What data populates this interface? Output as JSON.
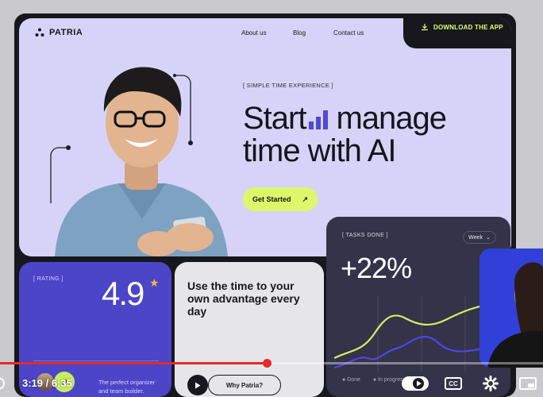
{
  "app": {
    "logo_text": "PATRIA",
    "nav": [
      "About us",
      "Blog",
      "Contact us"
    ],
    "download_label": "DOWNLOAD THE APP"
  },
  "hero": {
    "tag": "[ SIMPLE TIME EXPERIENCE ]",
    "headline_part1": "Start",
    "headline_part2": "manage",
    "headline_line2": "time with AI",
    "cta_label": "Get Started",
    "cta_icon": "arrow-up-right-icon"
  },
  "rating_card": {
    "label": "[ RATING ]",
    "value": "4.9",
    "organizer_text": "The perfect organizer and team builder."
  },
  "use_card": {
    "title": "Use the time to your own advantage every day",
    "button_label": "Why Patria?"
  },
  "tasks_card": {
    "label": "[ TASKS DONE ]",
    "period_select": "Week",
    "percent": "+22%",
    "legend_done": "Done",
    "legend_inprogress": "In progress"
  },
  "player": {
    "time": "3:19 / 6:35",
    "progress_fraction": 0.503
  },
  "colors": {
    "hero_bg": "#d7d3f8",
    "accent_lime": "#dcf86a",
    "rating_bg": "#4c45c8",
    "tasks_bg": "#343349",
    "progress_red": "#e32b2b"
  }
}
